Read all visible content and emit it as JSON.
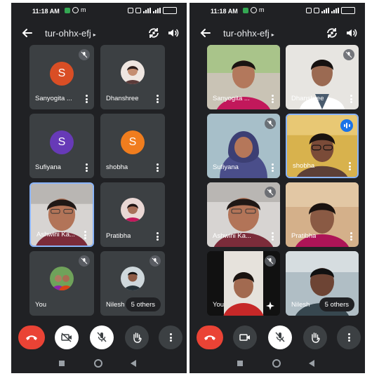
{
  "status": {
    "time": "11:18 AM",
    "notif_letter": "m",
    "battery": ""
  },
  "meeting": {
    "code": "tur-ohhx-efj",
    "caret": "▸"
  },
  "left": {
    "tiles": [
      {
        "name": "Sanyogita ...",
        "avatar_letter": "S",
        "avatar_color": "#d94e25",
        "muted": true
      },
      {
        "name": "Dhanshree",
        "avatar": "photo",
        "muted": false
      },
      {
        "name": "Sufiyana",
        "avatar_letter": "S",
        "avatar_color": "#673ab7",
        "muted": false
      },
      {
        "name": "shobha",
        "avatar_letter": "S",
        "avatar_color": "#f07d1e",
        "muted": false
      },
      {
        "name": "Ashwini Ka...",
        "video": true,
        "active": true,
        "muted": false
      },
      {
        "name": "Pratibha",
        "avatar": "photo",
        "muted": false
      },
      {
        "name": "You",
        "avatar": "photo",
        "muted": true
      },
      {
        "name": "Nilesh",
        "avatar": "photo",
        "muted": true
      }
    ],
    "others": "5 others"
  },
  "right": {
    "tiles": [
      {
        "name": "Sanyogita ...",
        "video": true,
        "muted": false
      },
      {
        "name": "Dhanshree",
        "video": true,
        "muted": true
      },
      {
        "name": "Sufiyana",
        "video": true,
        "muted": true
      },
      {
        "name": "shobha",
        "video": true,
        "speaking": true,
        "active": true
      },
      {
        "name": "Ashwini Ka...",
        "video": true,
        "muted": true
      },
      {
        "name": "Pratibha",
        "video": true,
        "muted": false
      },
      {
        "name": "You",
        "video": true,
        "muted": true
      },
      {
        "name": "Nilesh",
        "video": true,
        "muted": false
      }
    ],
    "others": "5 others"
  },
  "colors": {
    "end_call": "#ea4335",
    "tile_bg": "#3c4043",
    "screen_bg": "#202124",
    "active_border": "#8ab4f8",
    "speaking": "#1a73e8"
  },
  "icons": [
    "back-arrow-icon",
    "flip-camera-icon",
    "speaker-icon",
    "mic-off-icon",
    "more-vert-icon",
    "end-call-icon",
    "camera-off-icon",
    "camera-icon",
    "raise-hand-icon",
    "effects-sparkle-icon"
  ]
}
